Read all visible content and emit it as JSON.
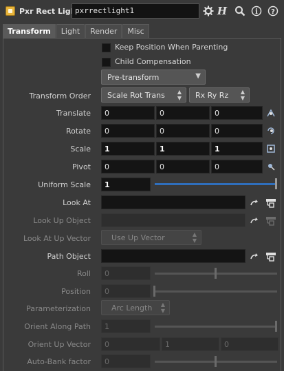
{
  "header": {
    "node_type": "Pxr Rect Light",
    "node_name": "pxrrectlight1",
    "icons": [
      "gear-icon",
      "help-h-icon",
      "search-icon",
      "info-icon",
      "question-icon"
    ]
  },
  "tabs": [
    {
      "label": "Transform",
      "active": true
    },
    {
      "label": "Light",
      "active": false
    },
    {
      "label": "Render",
      "active": false
    },
    {
      "label": "Misc",
      "active": false
    }
  ],
  "checkboxes": {
    "keep_position": "Keep Position When Parenting",
    "child_compensation": "Child Compensation"
  },
  "pre_transform": "Pre-transform",
  "transform_order": {
    "label": "Transform Order",
    "trs": "Scale Rot Trans",
    "rot": "Rx Ry Rz"
  },
  "translate": {
    "label": "Translate",
    "x": "0",
    "y": "0",
    "z": "0"
  },
  "rotate": {
    "label": "Rotate",
    "x": "0",
    "y": "0",
    "z": "0"
  },
  "scale": {
    "label": "Scale",
    "x": "1",
    "y": "1",
    "z": "1"
  },
  "pivot": {
    "label": "Pivot",
    "x": "0",
    "y": "0",
    "z": "0"
  },
  "uniform_scale": {
    "label": "Uniform Scale",
    "value": "1",
    "slider_fraction": 1.0
  },
  "look_at": {
    "label": "Look At",
    "value": ""
  },
  "look_up_object": {
    "label": "Look Up Object",
    "value": ""
  },
  "look_at_up_vector": {
    "label": "Look At Up Vector",
    "value": "Use Up Vector"
  },
  "path_object": {
    "label": "Path Object",
    "value": ""
  },
  "roll": {
    "label": "Roll",
    "value": "0",
    "slider_fraction": 0.5
  },
  "position": {
    "label": "Position",
    "value": "0",
    "slider_fraction": 0.0
  },
  "parameterization": {
    "label": "Parameterization",
    "value": "Arc Length"
  },
  "orient_along_path": {
    "label": "Orient Along Path",
    "value": "1"
  },
  "orient_up_vector": {
    "label": "Orient Up Vector",
    "x": "0",
    "y": "1",
    "z": "0"
  },
  "auto_bank": {
    "label": "Auto-Bank factor",
    "value": "0",
    "slider_fraction": 0.5
  }
}
